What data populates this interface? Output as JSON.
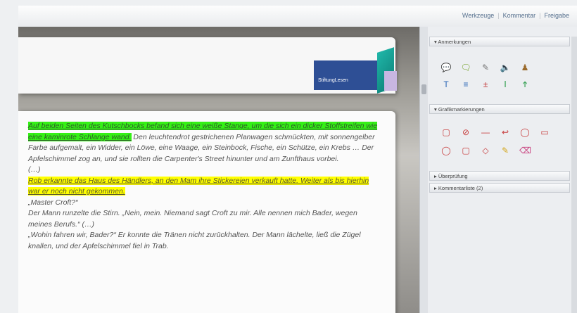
{
  "toolbar": {
    "links": [
      "Werkzeuge",
      "Kommentar",
      "Freigabe"
    ]
  },
  "document": {
    "logo_text": "StiftungLesen",
    "paragraphs": [
      {
        "highlight": "green",
        "highlighted": "Auf beiden Seiten des Kutschbocks befand sich eine weiße Stange, um die sich ein dicker Stoffstreifen wie eine kaminrote Schlange wand.",
        "rest": " Den leuchtendrot gestrichenen Planwagen schmückten, mit sonnengelber Farbe aufgemalt, ein Widder, ein Löwe, eine Waage, ein Steinbock, Fische, ein Schütze, ein Krebs … Der Apfelschimmel zog an, und sie rollten die Carpenter's Street hinunter und am Zunfthaus vorbei."
      },
      {
        "highlight": "none",
        "highlighted": "",
        "rest": "(…)"
      },
      {
        "highlight": "yellow",
        "highlighted": "Rob erkannte das Haus des Händlers, an den Mam ihre Stickereien verkauft hatte. Weiter als bis hierhin war er noch nicht gekommen.",
        "rest": ""
      },
      {
        "highlight": "none",
        "highlighted": "",
        "rest": "„Master Croft?“"
      },
      {
        "highlight": "none",
        "highlighted": "",
        "rest": "Der Mann runzelte die Stirn. „Nein, mein. Niemand sagt Croft zu mir. Alle nennen mich Bader, wegen meines Berufs.“ (…)"
      },
      {
        "highlight": "none",
        "highlighted": "",
        "rest": "„Wohin fahren wir, Bader?“ Er konnte die Tränen nicht zurückhalten. Der Mann lächelte, ließ die Zügel knallen, und der Apfelschimmel fiel in Trab."
      }
    ]
  },
  "panel": {
    "sections": [
      {
        "title": "▾ Anmerkungen",
        "icons": [
          "comment-icon",
          "sticky-note-icon",
          "stamp-icon",
          "audio-icon",
          "stamp-dropdown-icon"
        ]
      },
      {
        "title": "▾ Grafikmarkierungen",
        "icons": [
          "rectangle-icon",
          "line-icon",
          "arrow-icon",
          "oval-icon",
          "polygon-icon",
          "cloud-icon",
          "freeform-icon",
          "pencil-icon",
          "eraser-icon"
        ]
      },
      {
        "title": "▸ Überprüfung",
        "icons": []
      },
      {
        "title": "▸ Kommentarliste (2)",
        "icons": []
      }
    ]
  },
  "colors": {
    "highlight_green": "#35f016",
    "highlight_yellow": "#ffff00",
    "logo_blue": "#2e4f95",
    "logo_teal": "#1fb6a8"
  }
}
